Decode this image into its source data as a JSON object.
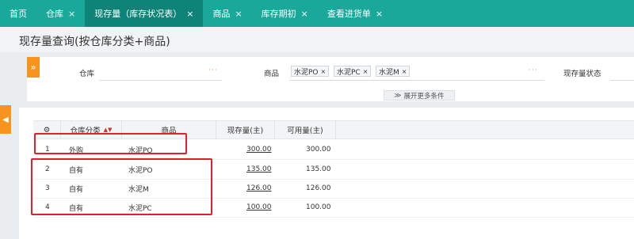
{
  "tabs": [
    {
      "label": "首页",
      "closable": false
    },
    {
      "label": "仓库",
      "closable": true
    },
    {
      "label": "现存量（库存状况表）",
      "closable": true,
      "active": true
    },
    {
      "label": "商品",
      "closable": true
    },
    {
      "label": "库存期初",
      "closable": true
    },
    {
      "label": "查看进货单",
      "closable": true
    }
  ],
  "close_glyph": "×",
  "page_title": "现存量查询(按仓库分类+商品)",
  "filters": {
    "warehouse_label": "仓库",
    "product_label": "商品",
    "product_chips": [
      "水泥PO",
      "水泥PC",
      "水泥M"
    ],
    "stock_status_label": "现存量状态",
    "ellipsis": "···",
    "expand_label": "展开更多条件"
  },
  "table": {
    "columns": [
      "仓库分类",
      "商品",
      "现存量(主)",
      "可用量(主)"
    ],
    "rows": [
      {
        "index": "1",
        "category": "外购",
        "product": "水泥PO",
        "current": "300.00",
        "available": "300.00"
      },
      {
        "index": "2",
        "category": "自有",
        "product": "水泥PO",
        "current": "135.00",
        "available": "135.00"
      },
      {
        "index": "3",
        "category": "自有",
        "product": "水泥M",
        "current": "126.00",
        "available": "126.00"
      },
      {
        "index": "4",
        "category": "自有",
        "product": "水泥PC",
        "current": "100.00",
        "available": "100.00"
      }
    ]
  },
  "colors": {
    "tabbar": "#1aa89a",
    "active_tab": "#0e8377",
    "accent": "#f7941d",
    "highlight": "#e0212b"
  }
}
